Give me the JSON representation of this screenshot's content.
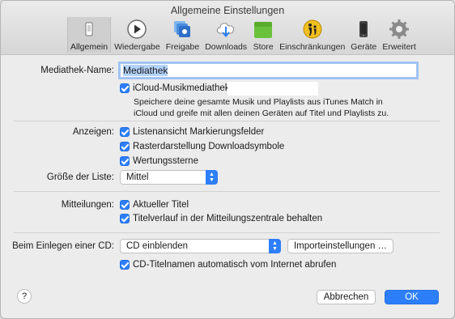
{
  "window": {
    "title": "Allgemeine Einstellungen"
  },
  "toolbar": {
    "items": [
      {
        "label": "Allgemein",
        "icon": "phone-switch-icon",
        "active": true
      },
      {
        "label": "Wiedergabe",
        "icon": "play-icon"
      },
      {
        "label": "Freigabe",
        "icon": "sharing-icon"
      },
      {
        "label": "Downloads",
        "icon": "download-cloud-icon"
      },
      {
        "label": "Store",
        "icon": "store-icon"
      },
      {
        "label": "Einschränkungen",
        "icon": "parental-controls-icon"
      },
      {
        "label": "Geräte",
        "icon": "device-icon"
      },
      {
        "label": "Erweitert",
        "icon": "gear-icon"
      }
    ]
  },
  "library": {
    "name_label": "Mediathek-Name:",
    "name_value": "Mediathek",
    "icloud_label": "iCloud-Musikmediathek",
    "icloud_checked": true,
    "icloud_desc": "Speichere deine gesamte Musik und Playlists aus iTunes Match in iCloud und greife mit allen deinen Geräten auf Titel und Playlists zu."
  },
  "display": {
    "label": "Anzeigen:",
    "options": [
      {
        "label": "Listenansicht Markierungsfelder",
        "checked": true
      },
      {
        "label": "Rasterdarstellung Downloadsymbole",
        "checked": true
      },
      {
        "label": "Wertungssterne",
        "checked": true
      }
    ],
    "list_size_label": "Größe der Liste:",
    "list_size_value": "Mittel"
  },
  "notifications": {
    "label": "Mitteilungen:",
    "options": [
      {
        "label": "Aktueller Titel",
        "checked": true
      },
      {
        "label": "Titelverlauf in der Mitteilungszentrale behalten",
        "checked": true
      }
    ]
  },
  "cd": {
    "label": "Beim Einlegen einer CD:",
    "action_value": "CD einblenden",
    "import_button": "Importeinstellungen …",
    "autoname_label": "CD-Titelnamen automatisch vom Internet abrufen",
    "autoname_checked": true
  },
  "footer": {
    "help": "?",
    "cancel": "Abbrechen",
    "ok": "OK"
  },
  "colors": {
    "accent": "#2d7ff9",
    "background": "#ececec"
  }
}
